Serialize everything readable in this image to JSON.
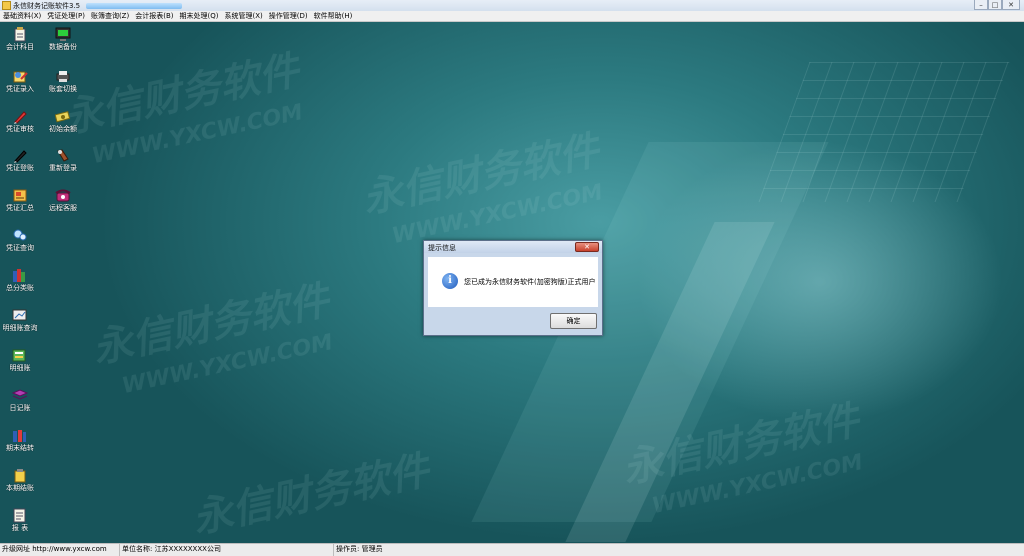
{
  "window": {
    "title": "永信财务记账软件3.5",
    "controls": {
      "minimize": "–",
      "maximize": "□",
      "close": "✕"
    }
  },
  "menu": [
    "基础资料(X)",
    "凭证处理(P)",
    "账簿查询(Z)",
    "会计报表(B)",
    "期末处理(Q)",
    "系统管理(X)",
    "操作管理(D)",
    "软件帮助(H)"
  ],
  "sidebar_left": [
    {
      "label": "会计科目",
      "icon": "clipboard-icon"
    },
    {
      "label": "凭证录入",
      "icon": "voucher-entry-icon"
    },
    {
      "label": "凭证审核",
      "icon": "pen-red-icon"
    },
    {
      "label": "凭证登账",
      "icon": "pen-black-icon"
    },
    {
      "label": "凭证汇总",
      "icon": "voucher-summary-icon"
    },
    {
      "label": "凭证查询",
      "icon": "voucher-query-icon"
    },
    {
      "label": "总分类账",
      "icon": "books-icon"
    },
    {
      "label": "明细账查询",
      "icon": "detail-query-icon"
    },
    {
      "label": "明细账",
      "icon": "detail-ledger-icon"
    },
    {
      "label": "日记账",
      "icon": "journal-icon"
    },
    {
      "label": "期末结转",
      "icon": "period-carry-icon"
    },
    {
      "label": "本期结账",
      "icon": "close-period-icon"
    },
    {
      "label": "报  表",
      "icon": "report-icon"
    }
  ],
  "sidebar_right": [
    {
      "label": "数据备份",
      "icon": "monitor-icon"
    },
    {
      "label": "账套切换",
      "icon": "printer-icon"
    },
    {
      "label": "初始余额",
      "icon": "money-icon"
    },
    {
      "label": "重新登录",
      "icon": "login-icon"
    },
    {
      "label": "远程客服",
      "icon": "phone-icon"
    }
  ],
  "dialog": {
    "title": "提示信息",
    "close_label": "✕",
    "message": "您已成为永信财务软件(加密狗版)正式用户",
    "ok_label": "确定"
  },
  "status": {
    "upgrade": "升级网址 http://www.yxcw.com",
    "unit": "单位名称: 江苏XXXXXXXX公司",
    "operator": "操作员: 管理员"
  },
  "watermarks": [
    "永信财务软件",
    "WWW.YXCW.COM"
  ],
  "colors": {
    "desktop_dark": "#17545a",
    "desktop_mid": "#2c7a80",
    "accent": "#1f5bbd"
  }
}
